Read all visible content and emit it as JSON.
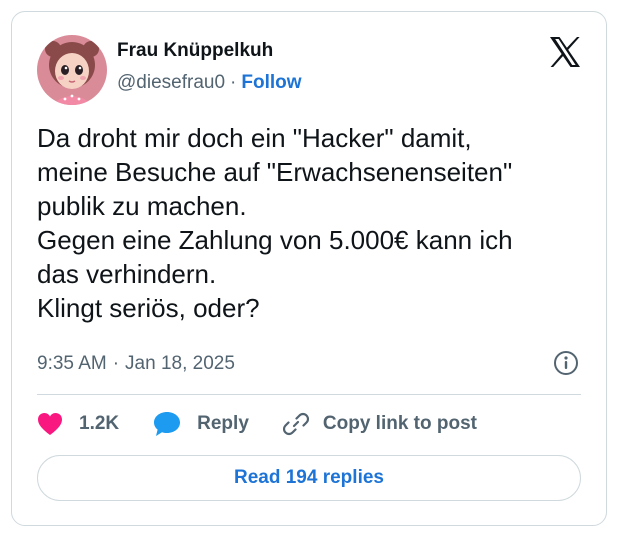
{
  "author": {
    "display_name": "Frau Knüppelkuh",
    "handle": "@diesefrau0",
    "separator": "·",
    "follow_label": "Follow",
    "avatar_icon": "cartoon-doll-avatar"
  },
  "brand": {
    "logo_icon": "x-logo-icon"
  },
  "tweet": {
    "text": "Da droht mir doch ein \"Hacker\" damit,\nmeine Besuche auf \"Erwachsenenseiten\"\npublik zu machen.\nGegen eine Zahlung von 5.000€ kann ich\ndas verhindern.\nKlingt seriös, oder?",
    "time": "9:35 AM",
    "separator": "·",
    "date": "Jan 18, 2025"
  },
  "actions": {
    "like_count": "1.2K",
    "reply_label": "Reply",
    "copy_label": "Copy link to post",
    "read_replies_label": "Read 194 replies"
  },
  "colors": {
    "accent": "#1d74d6",
    "like": "#f91880",
    "reply": "#1d9bf0",
    "text": "#0f1419",
    "muted": "#536471",
    "border": "#cfd9de"
  }
}
